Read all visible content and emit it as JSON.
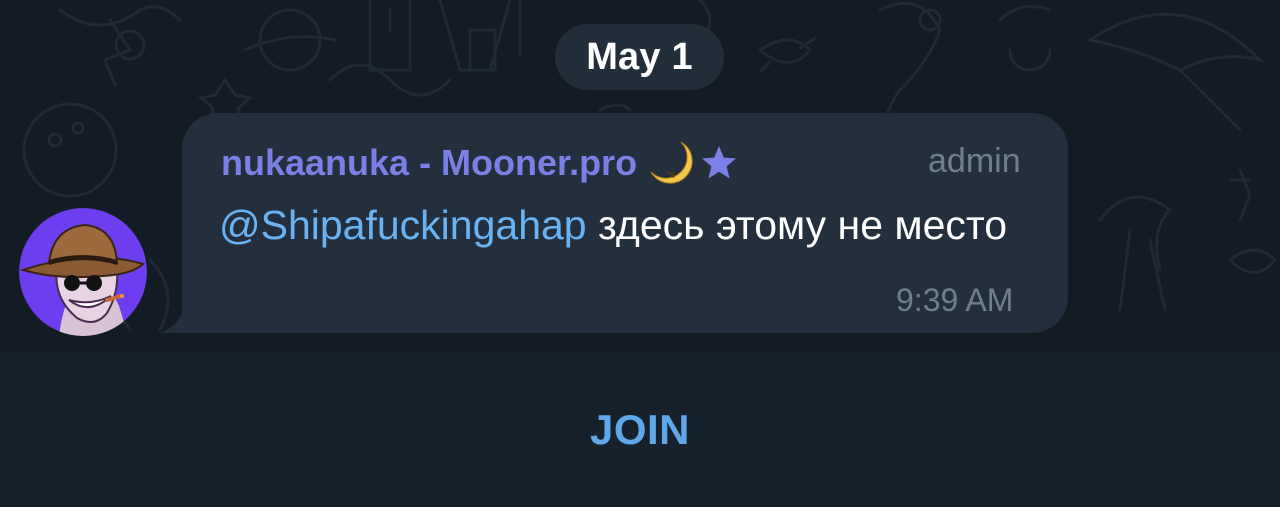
{
  "date_divider": "May 1",
  "message": {
    "sender": "nukaanuka - Mooner.pro",
    "sender_emoji": "crescent-moon-icon",
    "sender_badge": "star-icon",
    "role": "admin",
    "mention": "@Shipafuckingahap",
    "text": " здесь этому не место",
    "time": "9:39 AM"
  },
  "footer": {
    "join_label": "JOIN"
  },
  "colors": {
    "background": "#131c24",
    "bubble": "#242f3d",
    "sender_name": "#7b80e6",
    "mention": "#6ab3f3",
    "join": "#5ea8ea",
    "avatar_bg": "#6c3ef0"
  }
}
